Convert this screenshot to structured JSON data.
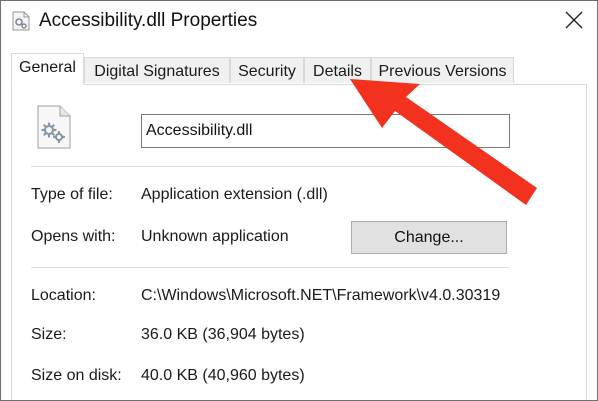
{
  "window": {
    "title": "Accessibility.dll Properties",
    "close_icon": "close-icon",
    "title_icon": "dll-file-icon"
  },
  "tabs": [
    {
      "label": "General",
      "active": true
    },
    {
      "label": "Digital Signatures",
      "active": false
    },
    {
      "label": "Security",
      "active": false
    },
    {
      "label": "Details",
      "active": false
    },
    {
      "label": "Previous Versions",
      "active": false
    }
  ],
  "general": {
    "file_icon": "gears-file-icon",
    "file_name": "Accessibility.dll",
    "type_label": "Type of file:",
    "type_value": "Application extension (.dll)",
    "opens_label": "Opens with:",
    "opens_value": "Unknown application",
    "change_button": "Change...",
    "location_label": "Location:",
    "location_value": "C:\\Windows\\Microsoft.NET\\Framework\\v4.0.30319",
    "size_label": "Size:",
    "size_value": "36.0 KB (36,904 bytes)",
    "size_on_disk_label": "Size on disk:",
    "size_on_disk_value": "40.0 KB (40,960 bytes)"
  },
  "annotation": {
    "arrow_color": "#f2321e",
    "points_to": "Details"
  }
}
